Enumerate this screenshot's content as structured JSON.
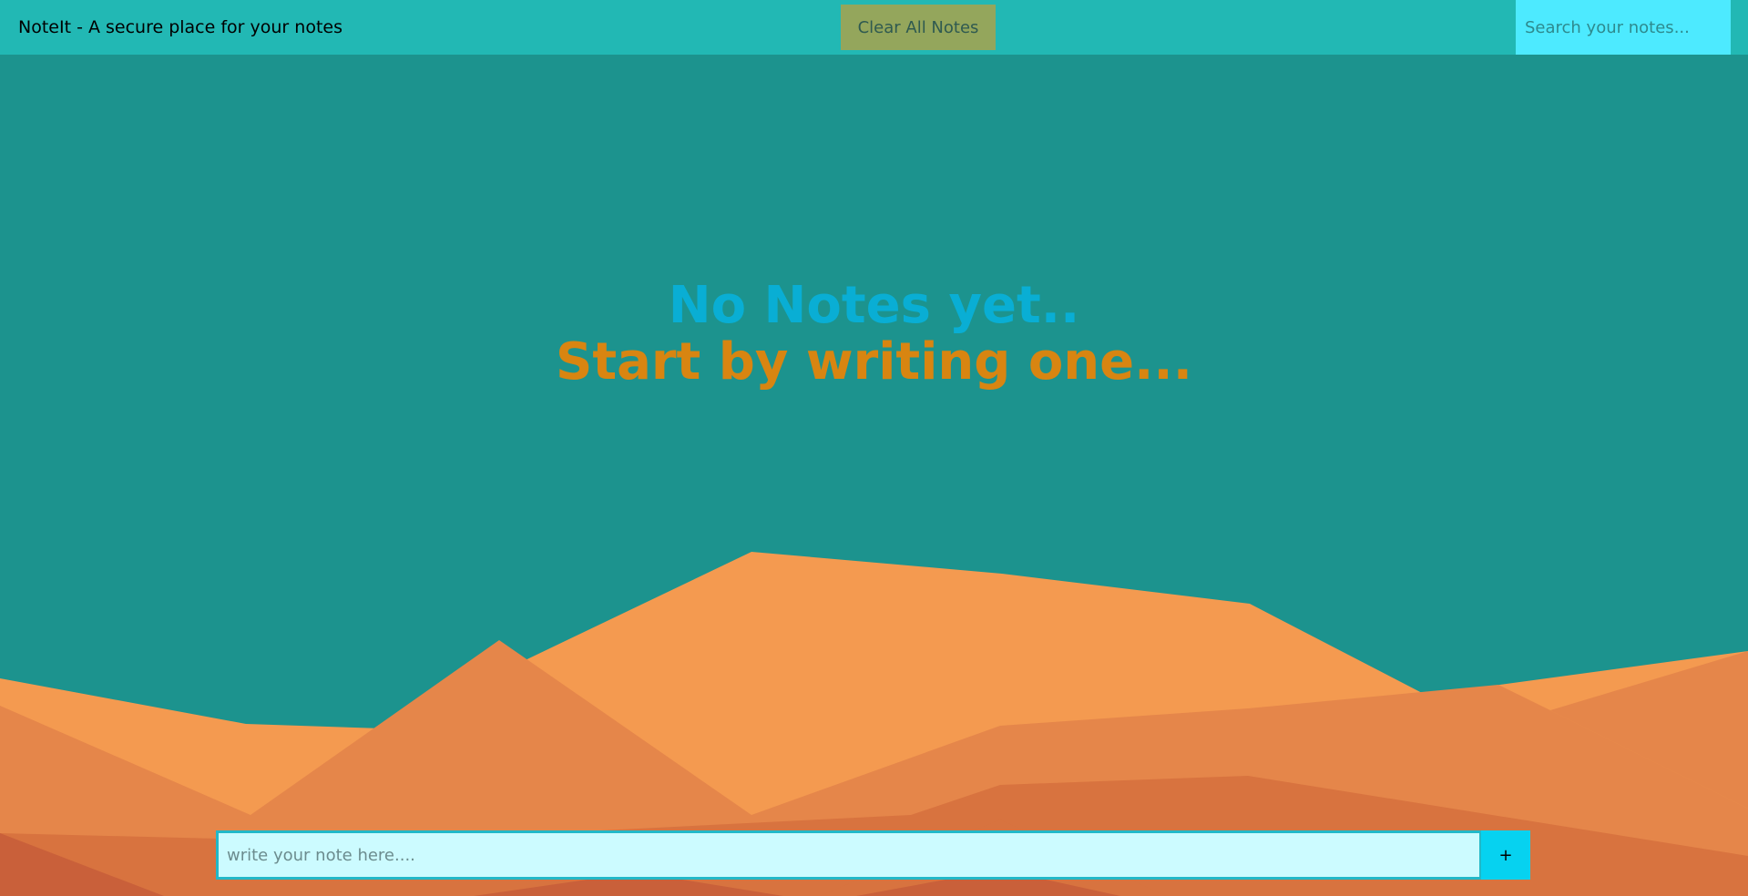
{
  "navbar": {
    "brand": "NoteIt - A secure place for your notes",
    "clear_label": "Clear All Notes",
    "search_placeholder": "Search your notes..."
  },
  "empty_state": {
    "line1": "No Notes yet..",
    "line2": "Start by writing one..."
  },
  "composer": {
    "placeholder": "write your note here....",
    "add_label": "+"
  },
  "colors": {
    "navbar": "#22b8b4",
    "background": "#1c938e",
    "clear_button": "#94a65c",
    "search_field": "#4deaff",
    "line1": "#09aed4",
    "line2": "#d88511",
    "note_field": "#ccfbff",
    "add_button": "#06d2f0"
  }
}
